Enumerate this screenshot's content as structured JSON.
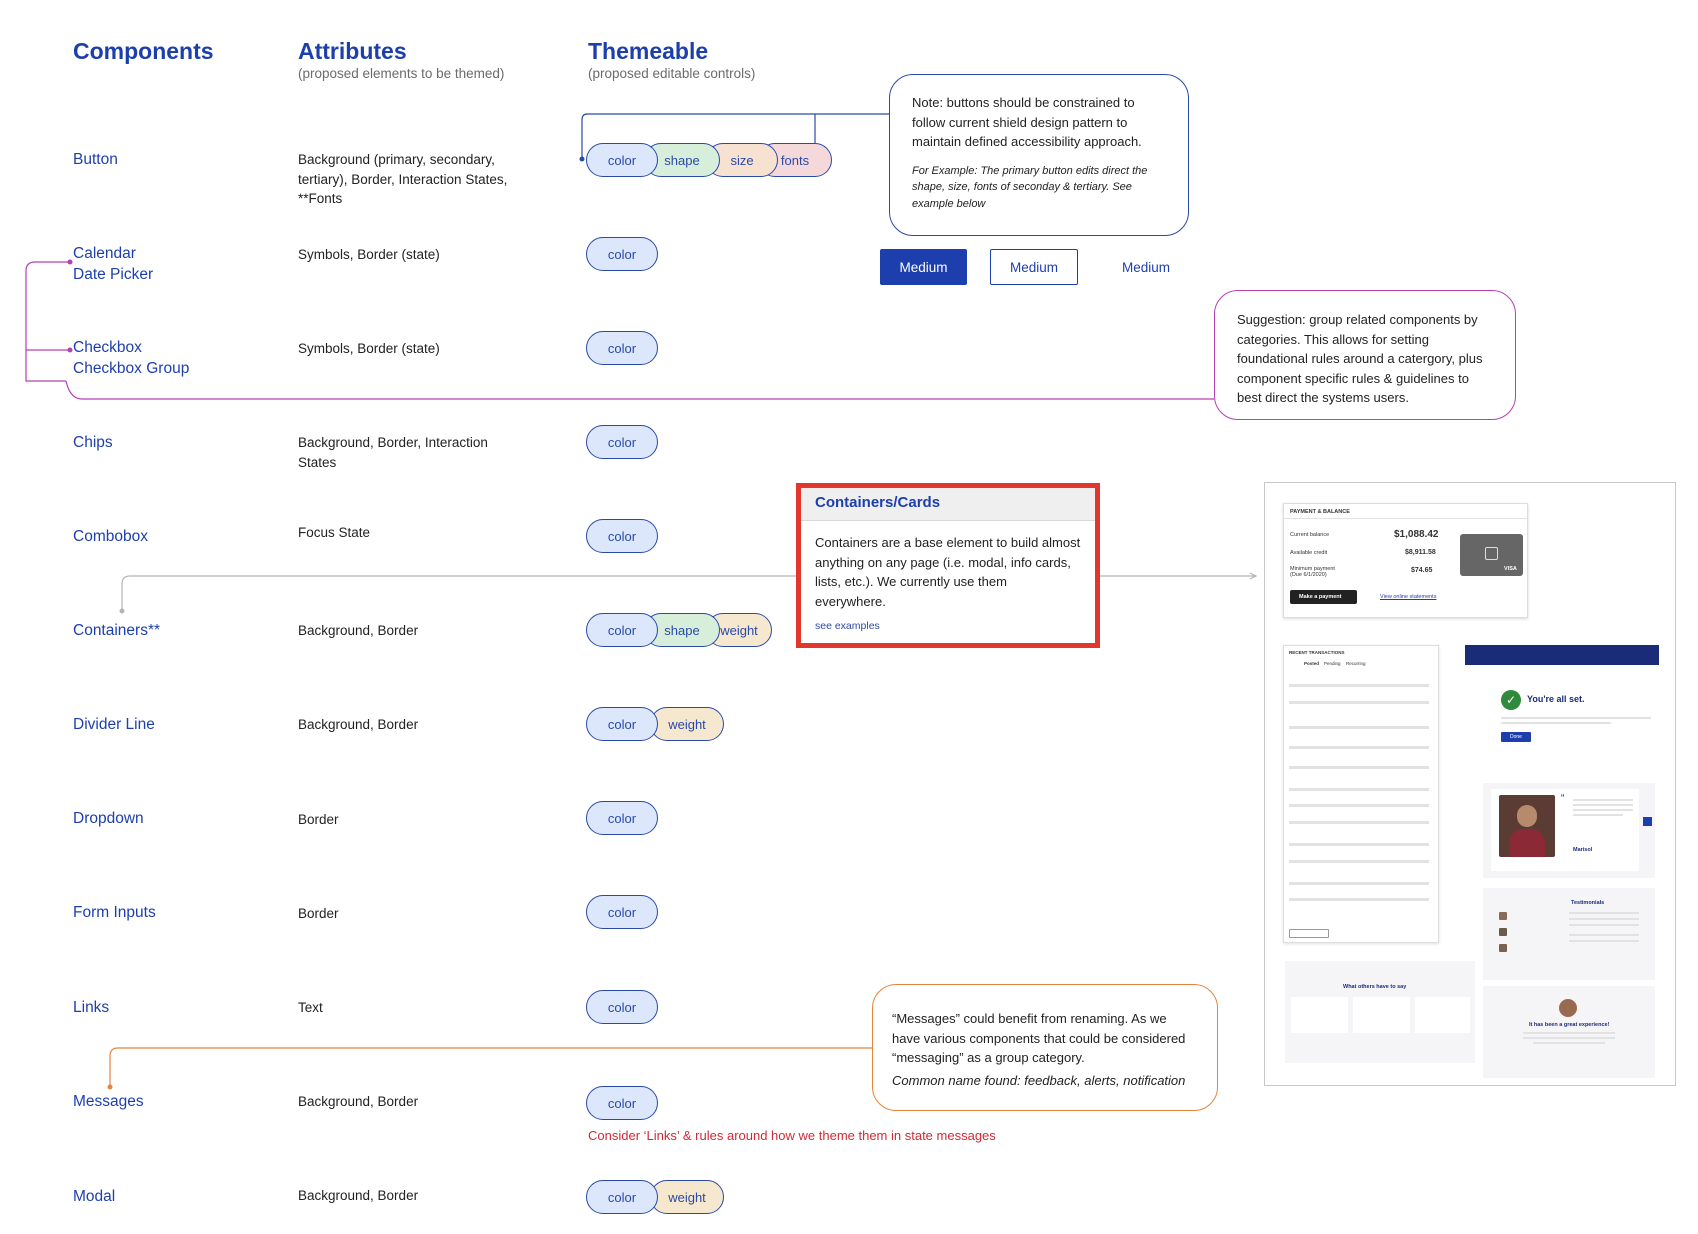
{
  "headers": {
    "components": "Components",
    "attributes": "Attributes",
    "attributes_sub": "(proposed elements to be themed)",
    "themeable": "Themeable",
    "themeable_sub": "(proposed editable controls)"
  },
  "pill_labels": {
    "color": "color",
    "shape": "shape",
    "size": "size",
    "fonts": "fonts",
    "weight": "weight"
  },
  "rows": [
    {
      "name": "Button",
      "attr": "Background (primary, secondary, tertiary), Border, Interaction States, **Fonts",
      "pills": [
        "color",
        "shape",
        "size",
        "fonts"
      ]
    },
    {
      "name": "Calendar\nDate Picker",
      "attr": "Symbols, Border (state)",
      "pills": [
        "color"
      ]
    },
    {
      "name": "Checkbox\nCheckbox Group",
      "attr": "Symbols, Border (state)",
      "pills": [
        "color"
      ]
    },
    {
      "name": "Chips",
      "attr": "Background, Border, Interaction States",
      "pills": [
        "color"
      ]
    },
    {
      "name": "Combobox",
      "attr": "Focus State",
      "pills": [
        "color"
      ]
    },
    {
      "name": "Containers**",
      "attr": "Background, Border",
      "pills": [
        "color",
        "shape",
        "weight"
      ]
    },
    {
      "name": "Divider Line",
      "attr": "Background, Border",
      "pills": [
        "color",
        "weight"
      ]
    },
    {
      "name": "Dropdown",
      "attr": "Border",
      "pills": [
        "color"
      ]
    },
    {
      "name": "Form Inputs",
      "attr": "Border",
      "pills": [
        "color"
      ]
    },
    {
      "name": "Links",
      "attr": "Text",
      "pills": [
        "color"
      ]
    },
    {
      "name": "Messages",
      "attr": "Background, Border",
      "pills": [
        "color"
      ]
    },
    {
      "name": "Modal",
      "attr": "Background, Border",
      "pills": [
        "color",
        "weight"
      ]
    }
  ],
  "notes": {
    "buttons": "Note: buttons should be constrained to follow current shield design pattern to maintain defined accessibility approach.",
    "buttons_example": "For Example: The primary button edits direct the shape, size, fonts of seconday & tertiary. See example below",
    "suggestion": "Suggestion: group related components by categories. This allows for setting foundational rules around a catergory, plus component specific rules & guidelines to best direct the systems users.",
    "messages": "“Messages” could benefit from renaming. As we have various components that could be considered “messaging” as a group category.",
    "messages_common": "Common name found:  feedback, alerts, notification"
  },
  "button_demo": {
    "primary": "Medium",
    "secondary": "Medium",
    "tertiary": "Medium",
    "primary_color": "#1d3fae"
  },
  "card": {
    "title": "Containers/Cards",
    "body": "Containers are a base element to build almost anything on any page (i.e. modal, info cards, lists, etc.). We currently use them everywhere.",
    "link": "see examples"
  },
  "warning": "Consider ‘Links’ & rules around how we theme them in state messages",
  "examples": {
    "payment_title": "PAYMENT & BALANCE",
    "current_balance_label": "Current balance",
    "current_balance": "$1,088.42",
    "available_credit_label": "Available credit",
    "available_credit": "$8,911.58",
    "minimum_payment_label": "Minimum payment",
    "minimum_payment_due": "(Due 6/1/2020)",
    "minimum_payment": "$74.65",
    "make_payment": "Make a payment",
    "view_statements": "View online statements",
    "card_brand": "VISA",
    "recent_title": "RECENT TRANSACTIONS",
    "tabs": [
      "Posted",
      "Pending",
      "Recurring"
    ],
    "all_set": "You're all set.",
    "done": "Done",
    "testimonials": "Testimonials",
    "what_others": "What others have to say",
    "great_experience": "It has been a great experience!",
    "person_name": "Marisol"
  },
  "colors": {
    "blue": "#1d3fae",
    "purple": "#b640b4",
    "orange": "#e5843c",
    "red": "#e1372c"
  }
}
